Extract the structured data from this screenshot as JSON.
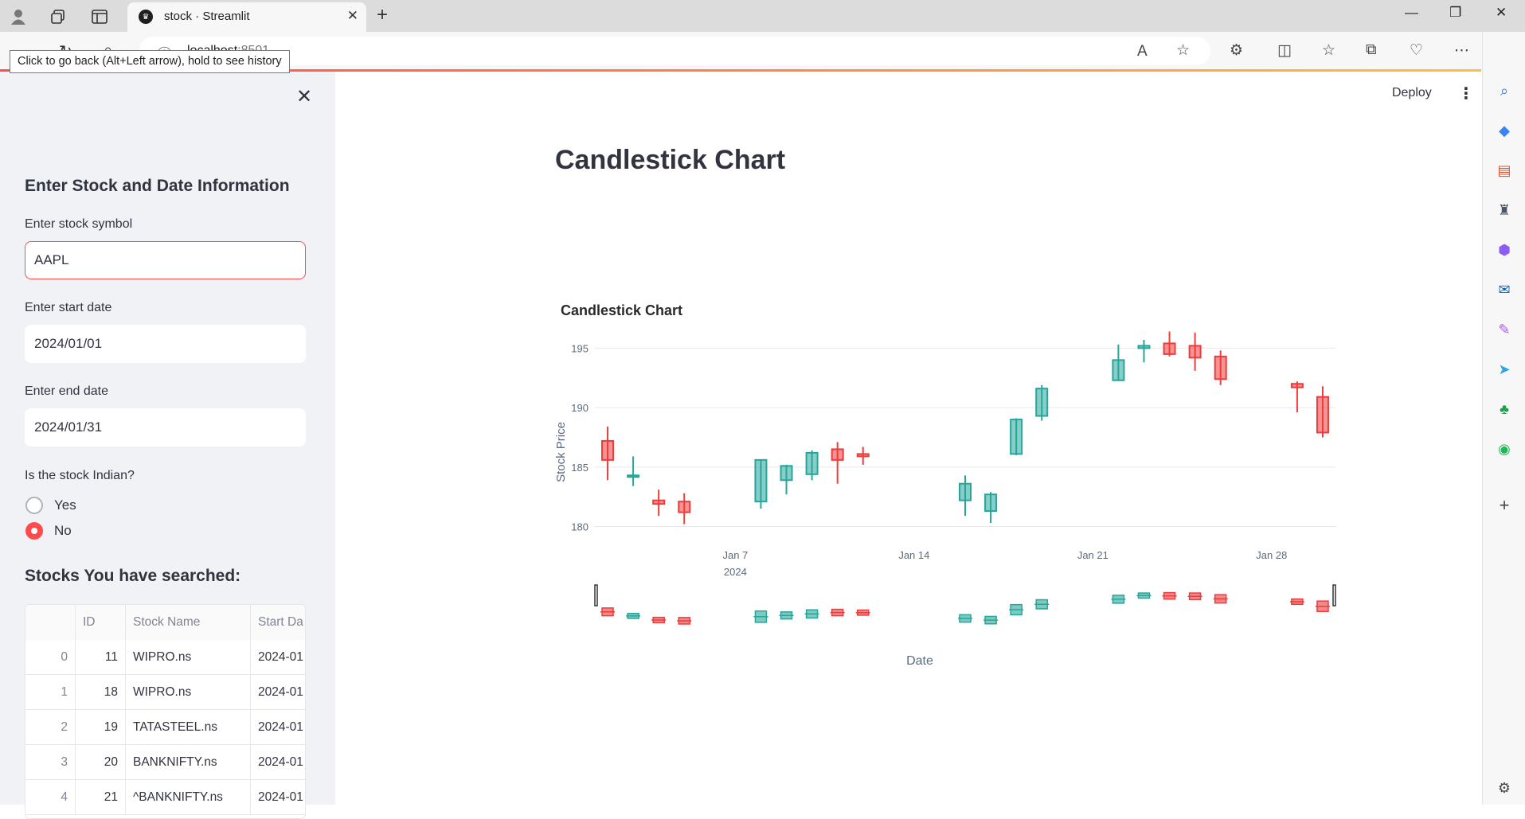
{
  "browser": {
    "tab_title": "stock · Streamlit",
    "url_host": "localhost",
    "url_port": ":8501",
    "tooltip": "Click to go back (Alt+Left arrow), hold to see history"
  },
  "header": {
    "deploy_label": "Deploy",
    "menu_icon": "⋮"
  },
  "sidebar": {
    "heading": "Enter Stock and Date Information",
    "symbol_label": "Enter stock symbol",
    "symbol_value": "AAPL",
    "start_label": "Enter start date",
    "start_value": "2024/01/01",
    "end_label": "Enter end date",
    "end_value": "2024/01/31",
    "indian_label": "Is the stock Indian?",
    "radio_options": [
      "Yes",
      "No"
    ],
    "radio_selected": "No",
    "searched_heading": "Stocks You have searched:",
    "table": {
      "columns": [
        "",
        "ID",
        "Stock Name",
        "Start Da"
      ],
      "rows": [
        [
          "0",
          "11",
          "WIPRO.ns",
          "2024-01"
        ],
        [
          "1",
          "18",
          "WIPRO.ns",
          "2024-01"
        ],
        [
          "2",
          "19",
          "TATASTEEL.ns",
          "2024-01"
        ],
        [
          "3",
          "20",
          "BANKNIFTY.ns",
          "2024-01"
        ],
        [
          "4",
          "21",
          "^BANKNIFTY.ns",
          "2024-01"
        ]
      ]
    }
  },
  "main": {
    "page_title": "Candlestick Chart"
  },
  "colors": {
    "increasing": "#26a69a",
    "decreasing": "#ef3b3b",
    "accent": "#ff4b4b"
  },
  "chart_data": {
    "type": "candlestick",
    "title": "Candlestick Chart",
    "xlabel": "Date",
    "ylabel": "Stock Price",
    "ylim": [
      179.5,
      196.5
    ],
    "y_ticks": [
      180,
      185,
      190,
      195
    ],
    "x_ticks": [
      "Jan 7",
      "Jan 14",
      "Jan 21",
      "Jan 28"
    ],
    "x_year_label": "2024",
    "grid": true,
    "legend": "none",
    "range_slider": true,
    "candles": [
      {
        "date": "2024-01-02",
        "open": 187.2,
        "high": 188.4,
        "low": 183.9,
        "close": 185.6
      },
      {
        "date": "2024-01-03",
        "open": 184.2,
        "high": 185.9,
        "low": 183.4,
        "close": 184.3
      },
      {
        "date": "2024-01-04",
        "open": 182.2,
        "high": 183.1,
        "low": 180.9,
        "close": 181.9
      },
      {
        "date": "2024-01-05",
        "open": 182.1,
        "high": 182.8,
        "low": 180.2,
        "close": 181.2
      },
      {
        "date": "2024-01-08",
        "open": 182.1,
        "high": 185.6,
        "low": 181.5,
        "close": 185.6
      },
      {
        "date": "2024-01-09",
        "open": 183.9,
        "high": 185.2,
        "low": 182.7,
        "close": 185.1
      },
      {
        "date": "2024-01-10",
        "open": 184.4,
        "high": 186.4,
        "low": 183.9,
        "close": 186.2
      },
      {
        "date": "2024-01-11",
        "open": 186.5,
        "high": 187.1,
        "low": 183.6,
        "close": 185.6
      },
      {
        "date": "2024-01-12",
        "open": 186.1,
        "high": 186.7,
        "low": 185.2,
        "close": 185.9
      },
      {
        "date": "2024-01-16",
        "open": 182.2,
        "high": 184.3,
        "low": 180.9,
        "close": 183.6
      },
      {
        "date": "2024-01-17",
        "open": 181.3,
        "high": 182.9,
        "low": 180.3,
        "close": 182.7
      },
      {
        "date": "2024-01-18",
        "open": 186.1,
        "high": 189.1,
        "low": 186.0,
        "close": 189.0
      },
      {
        "date": "2024-01-19",
        "open": 189.3,
        "high": 191.9,
        "low": 188.9,
        "close": 191.6
      },
      {
        "date": "2024-01-22",
        "open": 192.3,
        "high": 195.3,
        "low": 192.3,
        "close": 194.0
      },
      {
        "date": "2024-01-23",
        "open": 195.0,
        "high": 195.7,
        "low": 193.8,
        "close": 195.2
      },
      {
        "date": "2024-01-24",
        "open": 195.4,
        "high": 196.4,
        "low": 194.3,
        "close": 194.5
      },
      {
        "date": "2024-01-25",
        "open": 195.2,
        "high": 196.3,
        "low": 193.1,
        "close": 194.2
      },
      {
        "date": "2024-01-26",
        "open": 194.3,
        "high": 194.8,
        "low": 191.9,
        "close": 192.4
      },
      {
        "date": "2024-01-29",
        "open": 192.0,
        "high": 192.2,
        "low": 189.6,
        "close": 191.7
      },
      {
        "date": "2024-01-30",
        "open": 190.9,
        "high": 191.8,
        "low": 187.5,
        "close": 187.9
      }
    ]
  }
}
